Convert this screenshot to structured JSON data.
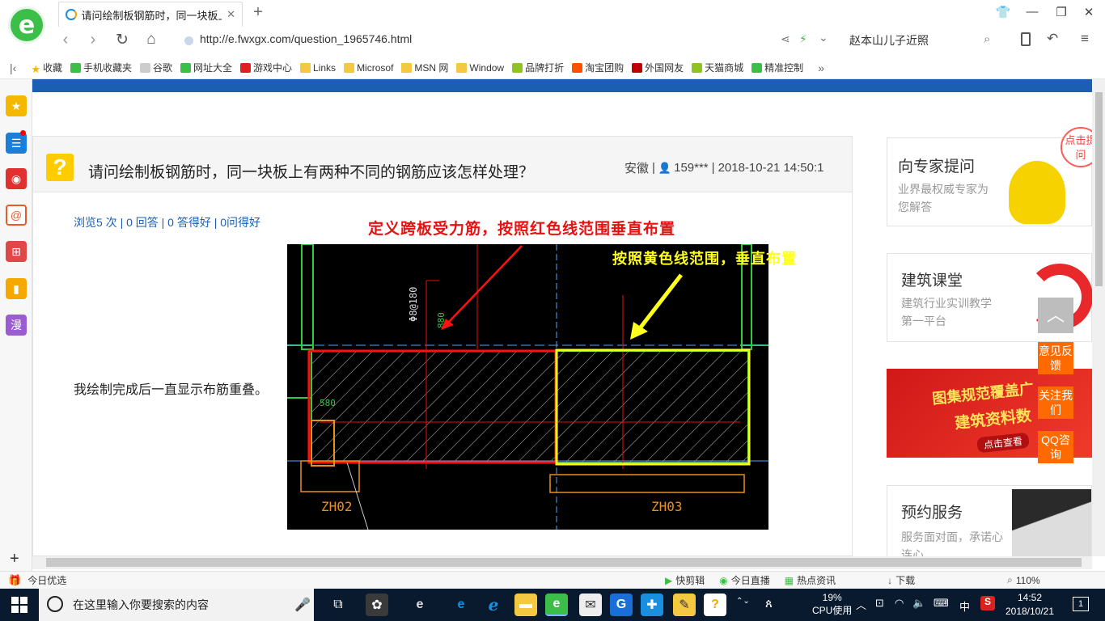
{
  "browser": {
    "tab_title": "请问绘制板钢筋时，同一块板上有两种不同的钢筋应该怎样处理？",
    "url": "http://e.fwxgx.com/question_1965746.html",
    "search_text": "赵本山儿子近照",
    "new_tab": "+",
    "logo_letter": "e"
  },
  "bookmarks": [
    {
      "label": "收藏",
      "icon": "star-icon",
      "color": "#f5b800"
    },
    {
      "label": "手机收藏夹",
      "icon": "phone-icon",
      "color": "#3cbf48"
    },
    {
      "label": "谷歌",
      "icon": "page-icon",
      "color": "#cccccc"
    },
    {
      "label": "网址大全",
      "icon": "globe-icon",
      "color": "#3cbf48"
    },
    {
      "label": "游戏中心",
      "icon": "game-icon",
      "color": "#e02020"
    },
    {
      "label": "Links",
      "icon": "folder-icon",
      "color": "#f5c842"
    },
    {
      "label": "Microsof",
      "icon": "folder-icon",
      "color": "#f5c842"
    },
    {
      "label": "MSN 网",
      "icon": "folder-icon",
      "color": "#f5c842"
    },
    {
      "label": "Window",
      "icon": "folder-icon",
      "color": "#f5c842"
    },
    {
      "label": "品牌打折",
      "icon": "leaf-icon",
      "color": "#8fc31f"
    },
    {
      "label": "淘宝团购",
      "icon": "tao-icon",
      "color": "#ff5000"
    },
    {
      "label": "外国网友",
      "icon": "flag-icon",
      "color": "#c00000"
    },
    {
      "label": "天猫商城",
      "icon": "leaf-icon",
      "color": "#8fc31f"
    },
    {
      "label": "精准控制",
      "icon": "wechat-icon",
      "color": "#3cbf48"
    }
  ],
  "question": {
    "title": "请问绘制板钢筋时，同一块板上有两种不同的钢筋应该怎样处理？",
    "location": "安徽",
    "user": "159***",
    "datetime": "2018-10-21 14:50:1",
    "icon_glyph": "?",
    "stats": "浏览5 次 | 0 回答 | 0 答得好 | 0问得好",
    "body": "我绘制完成后一直显示布筋重叠。"
  },
  "cad_image": {
    "red_caption": "定义跨板受力筋，按照红色线范围垂直布置",
    "yellow_caption": "按照黄色线范围，垂直布置",
    "labels": [
      "ZH02",
      "ZH03",
      "Φ8@180",
      "880",
      "580"
    ]
  },
  "right_cards": [
    {
      "title": "向专家提问",
      "subtitle": "业界最权威专家为您解答",
      "badge": "点击提问"
    },
    {
      "title": "建筑课堂",
      "subtitle": "建筑行业实训教学第一平台"
    },
    {
      "banner_line1": "图集规范覆盖广",
      "banner_line2": "建筑资料数",
      "banner_button": "点击查看"
    },
    {
      "title": "预约服务",
      "subtitle": "服务面对面，承诺心连心"
    }
  ],
  "float_buttons": [
    "意见反馈",
    "关注我们",
    "QQ咨询"
  ],
  "status_bar": {
    "left": "今日优选",
    "items": [
      "快剪辑",
      "今日直播",
      "热点资讯",
      "下载"
    ],
    "zoom": "110%"
  },
  "taskbar": {
    "search_placeholder": "在这里输入你要搜索的内容",
    "cpu_percent": "19%",
    "cpu_label": "CPU使用",
    "ime": "中",
    "time": "14:52",
    "date": "2018/10/21",
    "notification_count": "1"
  },
  "colors": {
    "brand_blue": "#1a5fb4",
    "accent_orange": "#ff6a00",
    "browser_green": "#3cbf48"
  }
}
